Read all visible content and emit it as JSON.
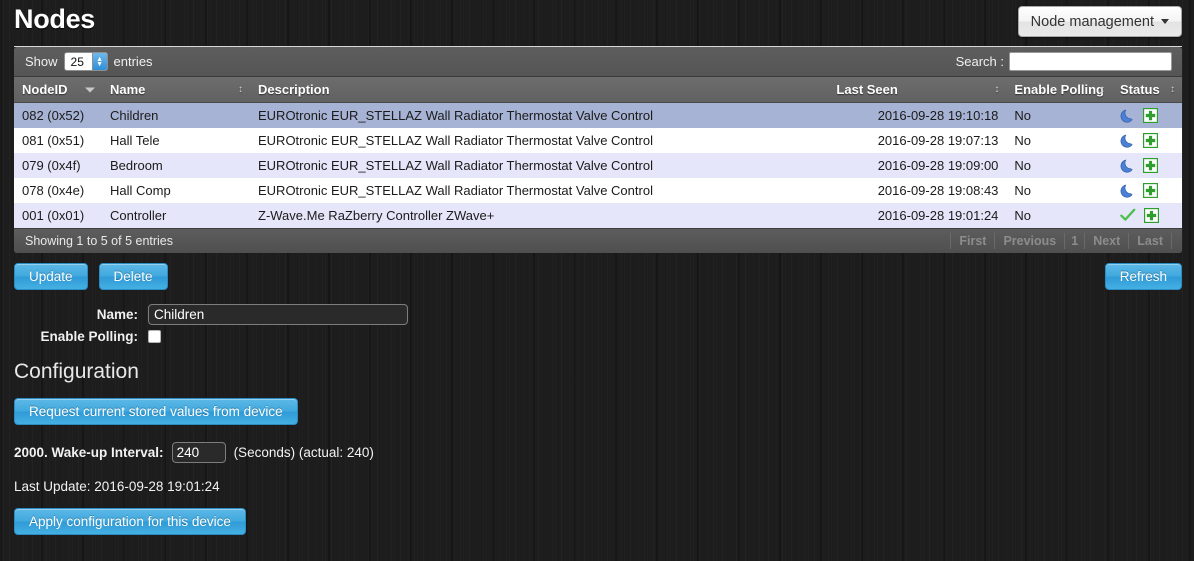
{
  "header": {
    "title": "Nodes",
    "node_management_label": "Node management",
    "caret_icon": "chevron-down-icon"
  },
  "datatable": {
    "length_prefix": "Show",
    "length_value": "25",
    "length_suffix": "entries",
    "search_label": "Search :",
    "search_value": "",
    "search_placeholder": "",
    "columns": [
      {
        "label": "NodeID",
        "sort": "desc"
      },
      {
        "label": "Name",
        "sort": "both"
      },
      {
        "label": "Description",
        "sort": "none"
      },
      {
        "label": "Last Seen",
        "sort": "both"
      },
      {
        "label": "Enable Polling",
        "sort": "both"
      },
      {
        "label": "Status",
        "sort": "both"
      }
    ],
    "rows": [
      {
        "nodeid": "082 (0x52)",
        "name": "Children",
        "description": "EUROtronic EUR_STELLAZ Wall Radiator Thermostat Valve Control",
        "last_seen": "2016-09-28 19:10:18",
        "enable_polling": "No",
        "status_icon": "moon-icon",
        "action_icon": "plus-icon",
        "selected": true
      },
      {
        "nodeid": "081 (0x51)",
        "name": "Hall Tele",
        "description": "EUROtronic EUR_STELLAZ Wall Radiator Thermostat Valve Control",
        "last_seen": "2016-09-28 19:07:13",
        "enable_polling": "No",
        "status_icon": "moon-icon",
        "action_icon": "plus-icon",
        "selected": false
      },
      {
        "nodeid": "079 (0x4f)",
        "name": "Bedroom",
        "description": "EUROtronic EUR_STELLAZ Wall Radiator Thermostat Valve Control",
        "last_seen": "2016-09-28 19:09:00",
        "enable_polling": "No",
        "status_icon": "moon-icon",
        "action_icon": "plus-icon",
        "selected": false
      },
      {
        "nodeid": "078 (0x4e)",
        "name": "Hall Comp",
        "description": "EUROtronic EUR_STELLAZ Wall Radiator Thermostat Valve Control",
        "last_seen": "2016-09-28 19:08:43",
        "enable_polling": "No",
        "status_icon": "moon-icon",
        "action_icon": "plus-icon",
        "selected": false
      },
      {
        "nodeid": "001 (0x01)",
        "name": "Controller",
        "description": "Z-Wave.Me RaZberry Controller ZWave+",
        "last_seen": "2016-09-28 19:01:24",
        "enable_polling": "No",
        "status_icon": "check-icon",
        "action_icon": "plus-icon",
        "selected": false
      }
    ],
    "info": "Showing 1 to 5 of 5 entries",
    "pagination": [
      "First",
      "Previous",
      "1",
      "Next",
      "Last"
    ]
  },
  "actions": {
    "update_label": "Update",
    "delete_label": "Delete",
    "refresh_label": "Refresh"
  },
  "form": {
    "name_label": "Name:",
    "name_value": "Children",
    "enable_polling_label": "Enable Polling:",
    "enable_polling_checked": false
  },
  "configuration": {
    "title": "Configuration",
    "request_button_label": "Request current stored values from device",
    "param_name": "2000. Wake-up Interval:",
    "param_value": "240",
    "param_units": "(Seconds) (actual: 240)",
    "last_update": "Last Update: 2016-09-28 19:01:24",
    "apply_button_label": "Apply configuration for this device"
  },
  "colors": {
    "page_background": "#1d1d1d",
    "accent_blue": "#3fa9dd",
    "selected_row": "#a7b3d4",
    "alt_row": "#e6e6fa",
    "status_ok": "#34a832",
    "status_sleep": "#4a7fd4"
  }
}
